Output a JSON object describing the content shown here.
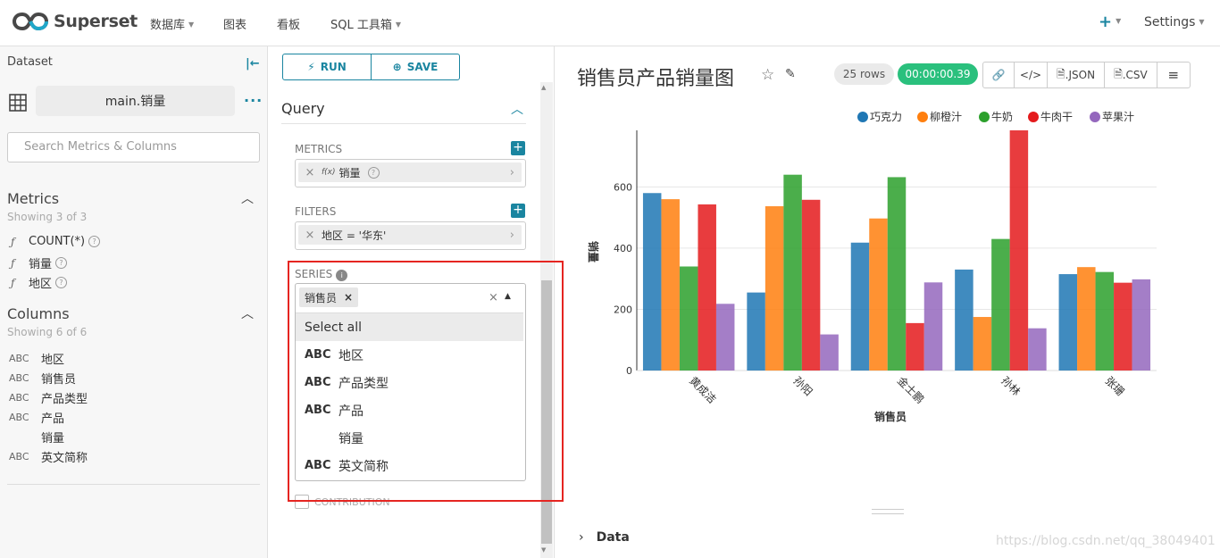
{
  "header": {
    "brand": "Superset",
    "nav": [
      "数据库",
      "图表",
      "看板",
      "SQL 工具箱"
    ],
    "plus": "+",
    "settings": "Settings"
  },
  "left": {
    "dataset_label": "Dataset",
    "dataset_name": "main.销量",
    "search_placeholder": "Search Metrics & Columns",
    "metrics_title": "Metrics",
    "metrics_sub": "Showing 3 of 3",
    "metrics": [
      "COUNT(*)",
      "销量",
      "地区"
    ],
    "columns_title": "Columns",
    "columns_sub": "Showing 6 of 6",
    "columns": [
      {
        "type": "ABC",
        "name": "地区"
      },
      {
        "type": "ABC",
        "name": "销售员"
      },
      {
        "type": "ABC",
        "name": "产品类型"
      },
      {
        "type": "ABC",
        "name": "产品"
      },
      {
        "type": "",
        "name": "销量"
      },
      {
        "type": "ABC",
        "name": "英文简称"
      }
    ]
  },
  "mid": {
    "run": "RUN",
    "save": "SAVE",
    "query_title": "Query",
    "metrics_label": "METRICS",
    "metric_value": "销量",
    "metric_fx": "f(x)",
    "filters_label": "FILTERS",
    "filter_value": "地区 = '华东'",
    "series_label": "SERIES",
    "series_tag": "销售员",
    "dropdown": [
      {
        "type": "",
        "name": "Select all"
      },
      {
        "type": "ABC",
        "name": "地区"
      },
      {
        "type": "ABC",
        "name": "产品类型"
      },
      {
        "type": "ABC",
        "name": "产品"
      },
      {
        "type": "",
        "name": "销量"
      },
      {
        "type": "ABC",
        "name": "英文简称"
      }
    ],
    "contribution": "CONTRIBUTION"
  },
  "right": {
    "title": "销售员产品销量图",
    "rows": "25 rows",
    "timer": "00:00:00.39",
    "json_btn": ".JSON",
    "csv_btn": ".CSV",
    "data_label": "Data",
    "watermark": "https://blog.csdn.net/qq_38049401"
  },
  "colors": {
    "accent": "#1a85a0",
    "timer_bg": "#2ac07d",
    "highlight": "#e52521"
  },
  "chart_data": {
    "type": "bar",
    "categories": [
      "黄成洁",
      "孙阳",
      "金士鹏",
      "孙林",
      "张珊"
    ],
    "series": [
      {
        "name": "巧克力",
        "color": "#1f77b4",
        "values": [
          580,
          255,
          418,
          330,
          315
        ]
      },
      {
        "name": "柳橙汁",
        "color": "#ff7f0e",
        "values": [
          560,
          537,
          497,
          175,
          338
        ]
      },
      {
        "name": "牛奶",
        "color": "#2ca02c",
        "values": [
          340,
          640,
          632,
          430,
          322
        ]
      },
      {
        "name": "牛肉干",
        "color": "#e41a1c",
        "values": [
          543,
          558,
          155,
          785,
          287
        ]
      },
      {
        "name": "苹果汁",
        "color": "#9467bd",
        "values": [
          218,
          118,
          288,
          138,
          298
        ]
      }
    ],
    "xlabel": "销售员",
    "ylabel": "销量",
    "ylim": [
      0,
      785
    ],
    "yticks": [
      0,
      200,
      400,
      600
    ],
    "legend": "top-right",
    "grid": true
  }
}
